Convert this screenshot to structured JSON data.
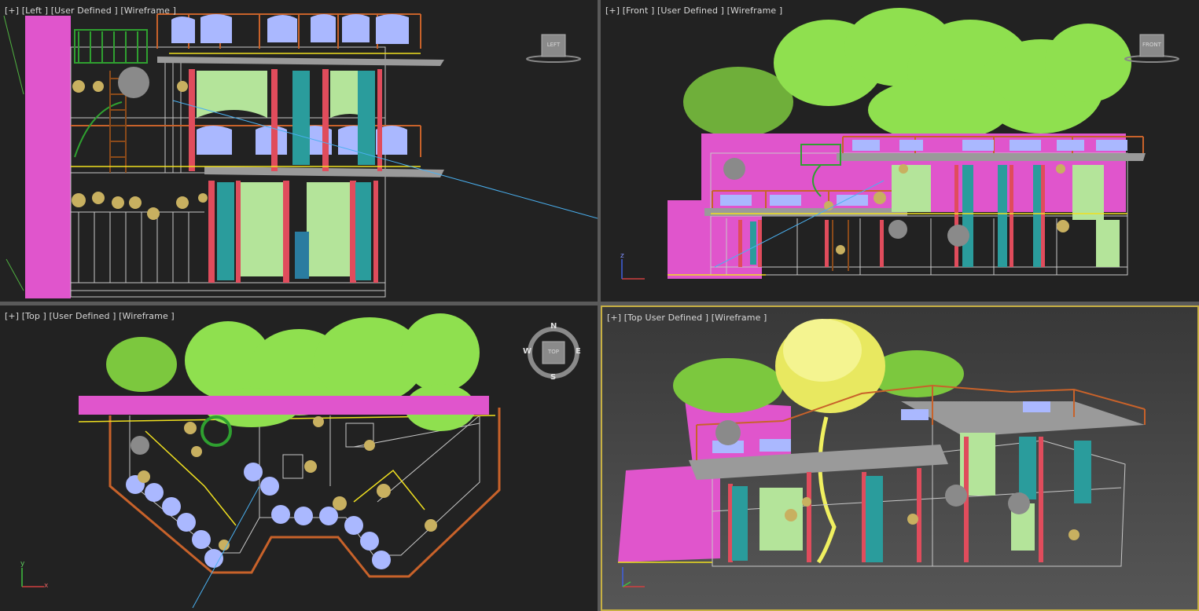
{
  "viewports": [
    {
      "id": "left",
      "label": "[+] [Left ] [User Defined ] [Wireframe ]",
      "cube": "LEFT"
    },
    {
      "id": "front",
      "label": "[+] [Front ] [User Defined ] [Wireframe ]",
      "cube": "FRONT"
    },
    {
      "id": "top",
      "label": "[+] [Top ] [User Defined ] [Wireframe ]",
      "cube": "TOP",
      "compass": {
        "n": "N",
        "s": "S",
        "e": "E",
        "w": "W"
      }
    },
    {
      "id": "persp",
      "label": "[+] [Top User Defined ] [Wireframe ]"
    }
  ],
  "axes": {
    "x": "x",
    "y": "y",
    "z": "z"
  },
  "colors": {
    "viewport_bg": "#222222",
    "separator": "#5a5a5a",
    "active_border": "#c7b043",
    "tree": "#8fe04f",
    "pink": "#e055cc",
    "wire": "#cccccc",
    "orange": "#c8622a",
    "red": "#e04c5c",
    "teal": "#2a9c9c",
    "yellow": "#f0e020",
    "blue": "#aab8ff",
    "curtain": "#b4e49a"
  }
}
